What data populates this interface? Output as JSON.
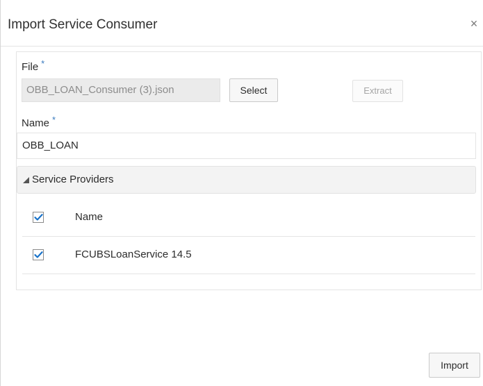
{
  "dialog": {
    "title": "Import Service Consumer",
    "close_glyph": "×"
  },
  "form": {
    "file_label": "File",
    "required_mark": "*",
    "file_value": "OBB_LOAN_Consumer (3).json",
    "select_label": "Select",
    "extract_label": "Extract",
    "name_label": "Name",
    "name_value": "OBB_LOAN"
  },
  "providers": {
    "section_title": "Service Providers",
    "header": {
      "label": "Name",
      "checked": true
    },
    "rows": [
      {
        "label": "FCUBSLoanService 14.5",
        "checked": true
      }
    ]
  },
  "footer": {
    "import_label": "Import"
  },
  "colors": {
    "accent": "#1a73c9",
    "required": "#3a7bbf",
    "disabled_field": "#ebebeb"
  }
}
